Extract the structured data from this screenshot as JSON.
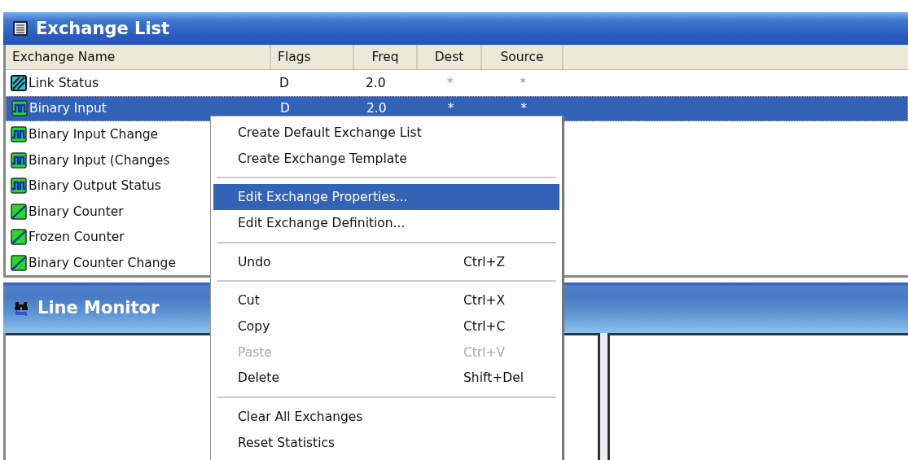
{
  "exchange_list": {
    "title": "Exchange List",
    "columns": [
      "Exchange Name",
      "Flags",
      "Freq",
      "Dest",
      "Source"
    ],
    "rows": [
      {
        "kind": "link",
        "name": "Link Status",
        "flags": "D",
        "freq": "2.0",
        "dest": "*",
        "source": "*",
        "selected": false
      },
      {
        "kind": "binary",
        "name": "Binary Input",
        "flags": "D",
        "freq": "2.0",
        "dest": "*",
        "source": "*",
        "selected": true
      },
      {
        "kind": "binary",
        "name": "Binary Input Change",
        "selected": false
      },
      {
        "kind": "binary",
        "name": "Binary Input (Changes",
        "selected": false
      },
      {
        "kind": "binary",
        "name": "Binary Output Status",
        "selected": false
      },
      {
        "kind": "counter",
        "name": "Binary Counter",
        "selected": false
      },
      {
        "kind": "counter",
        "name": "Frozen Counter",
        "selected": false
      },
      {
        "kind": "counter",
        "name": "Binary Counter Change",
        "selected": false
      }
    ]
  },
  "line_monitor": {
    "title": "Line Monitor"
  },
  "context_menu": [
    {
      "kind": "item",
      "label": "Create Default Exchange List",
      "disabled": false,
      "selected": false
    },
    {
      "kind": "item",
      "label": "Create Exchange Template",
      "disabled": false,
      "selected": false
    },
    {
      "kind": "separator"
    },
    {
      "kind": "item",
      "label": "Edit Exchange Properties...",
      "disabled": false,
      "selected": true
    },
    {
      "kind": "item",
      "label": "Edit Exchange Definition...",
      "disabled": false,
      "selected": false
    },
    {
      "kind": "separator"
    },
    {
      "kind": "item",
      "label": "Undo",
      "shortcut": "Ctrl+Z",
      "disabled": false,
      "selected": false
    },
    {
      "kind": "separator"
    },
    {
      "kind": "item",
      "label": "Cut",
      "shortcut": "Ctrl+X",
      "disabled": false,
      "selected": false
    },
    {
      "kind": "item",
      "label": "Copy",
      "shortcut": "Ctrl+C",
      "disabled": false,
      "selected": false
    },
    {
      "kind": "item",
      "label": "Paste",
      "shortcut": "Ctrl+V",
      "disabled": true,
      "selected": false
    },
    {
      "kind": "item",
      "label": "Delete",
      "shortcut": "Shift+Del",
      "disabled": false,
      "selected": false
    },
    {
      "kind": "separator"
    },
    {
      "kind": "item",
      "label": "Clear All Exchanges",
      "disabled": false,
      "selected": false
    },
    {
      "kind": "item",
      "label": "Reset Statistics",
      "disabled": false,
      "selected": false
    }
  ]
}
